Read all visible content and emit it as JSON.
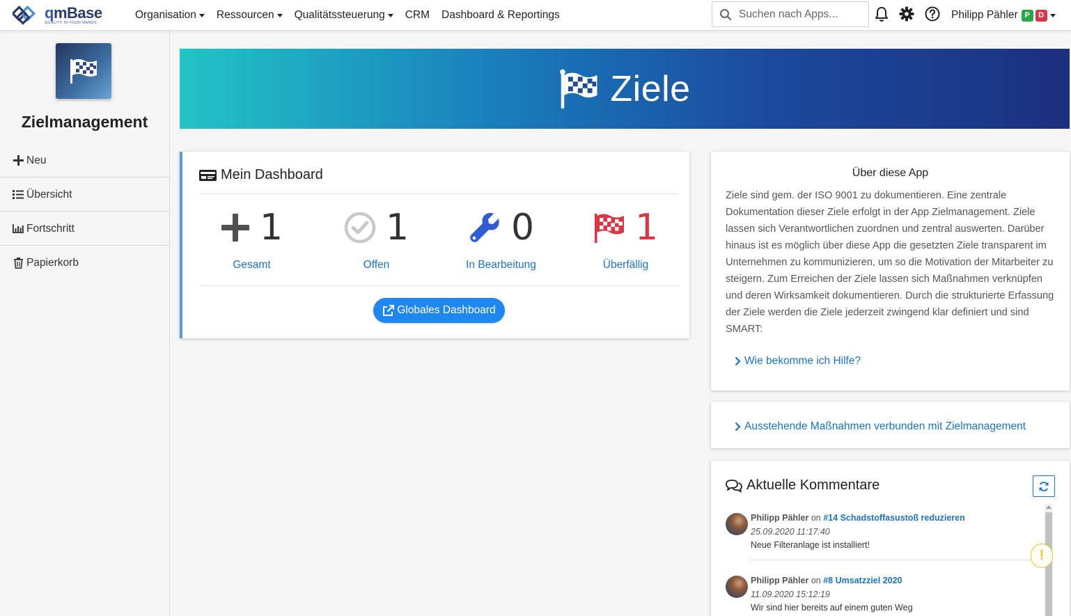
{
  "nav": {
    "logo_name_q": "q",
    "logo_name_rest": "mBase",
    "logo_tagline": "QUALITY IN YOUR HANDS",
    "menu": [
      {
        "label": "Organisation",
        "dropdown": true
      },
      {
        "label": "Ressourcen",
        "dropdown": true
      },
      {
        "label": "Qualitätssteuerung",
        "dropdown": true
      },
      {
        "label": "CRM",
        "dropdown": false
      },
      {
        "label": "Dashboard & Reportings",
        "dropdown": false
      }
    ],
    "search_placeholder": "Suchen nach Apps...",
    "user_name": "Philipp Pähler",
    "badge_p": "P",
    "badge_d": "D"
  },
  "sidebar": {
    "app_title": "Zielmanagement",
    "items": [
      {
        "label": "Neu",
        "icon": "plus-icon"
      },
      {
        "label": "Übersicht",
        "icon": "list-icon"
      },
      {
        "label": "Fortschritt",
        "icon": "bar-chart-icon"
      },
      {
        "label": "Papierkorb",
        "icon": "trash-icon"
      }
    ]
  },
  "banner": {
    "title": "Ziele"
  },
  "dashboard": {
    "title": "Mein Dashboard",
    "stats": [
      {
        "value": "1",
        "label": "Gesamt",
        "icon": "plus-icon"
      },
      {
        "value": "1",
        "label": "Offen",
        "icon": "check-circle-icon"
      },
      {
        "value": "0",
        "label": "In Bearbeitung",
        "icon": "wrench-icon"
      },
      {
        "value": "1",
        "label": "Überfällig",
        "icon": "checkered-flag-icon"
      }
    ],
    "button_label": "Globales Dashboard"
  },
  "about": {
    "title": "Über diese App",
    "text": "Ziele sind gem. der ISO 9001 zu dokumentieren. Eine zentrale Dokumentation dieser Ziele erfolgt in der App Zielmanagement. Ziele lassen sich Verantwortlichen zuordnen und zentral auswerten. Darüber hinaus ist es möglich über diese App die gesetzten Ziele transparent im Unternehmen zu kommunizieren, um so die Motivation der Mitarbeiter zu steigern. Zum Erreichen der Ziele lassen sich Maßnahmen verknüpfen und deren Wirksamkeit dokumentieren. Durch die strukturierte Erfassung der Ziele werden die Ziele jederzeit zwingend klar definiert und sind SMART:",
    "help_link": "Wie bekomme ich Hilfe?"
  },
  "pending": {
    "link": "Ausstehende Maßnahmen verbunden mit Zielmanagement"
  },
  "comments": {
    "title": "Aktuelle Kommentare",
    "items": [
      {
        "author": "Philipp Pähler",
        "on": "on",
        "target": "#14 Schadstoffasustoß reduzieren",
        "date": "25.09.2020 11:17:40",
        "text": "Neue Filteranlage ist installiert!"
      },
      {
        "author": "Philipp Pähler",
        "on": "on",
        "target": "#8 Umsatzziel 2020",
        "date": "11.09.2020 15:12:19",
        "text": "Wir sind hier bereits auf einem guten Weg"
      }
    ]
  },
  "colors": {
    "accent": "#1e88f0",
    "link": "#1a73c9",
    "danger": "#dc3545",
    "success": "#28a745",
    "warning": "#f0c419"
  }
}
